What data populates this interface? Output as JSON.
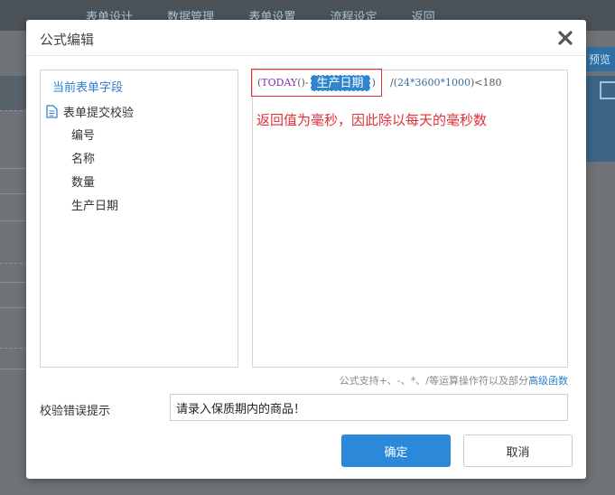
{
  "background": {
    "tabs": [
      "表单设计",
      "数据管理",
      "表单设置",
      "流程设定",
      "返回"
    ],
    "preview_label": "预览"
  },
  "dialog": {
    "title": "公式编辑",
    "field_panel": {
      "title": "当前表单字段",
      "root_label": "表单提交校验",
      "fields": [
        "编号",
        "名称",
        "数量",
        "生产日期"
      ]
    },
    "formula": {
      "open_paren": "(",
      "fn_name": "TODAY",
      "fn_parens": "()",
      "minus": "-",
      "field_chip": "生产日期",
      "close_paren": ")",
      "rest_op": "/(",
      "rest_expr": "24*3600*1000",
      "rest_close": ")<180",
      "annotation": "返回值为毫秒，因此除以每天的毫秒数"
    },
    "support_text": "公式支持+、-、*、/等运算操作符以及部分",
    "support_link": "高级函数",
    "error_label": "校验错误提示",
    "error_value": "请录入保质期内的商品！",
    "ok_label": "确定",
    "cancel_label": "取消"
  },
  "colors": {
    "accent": "#2c88d9",
    "highlight_border": "#e0303a",
    "annotation": "#e0303a"
  }
}
